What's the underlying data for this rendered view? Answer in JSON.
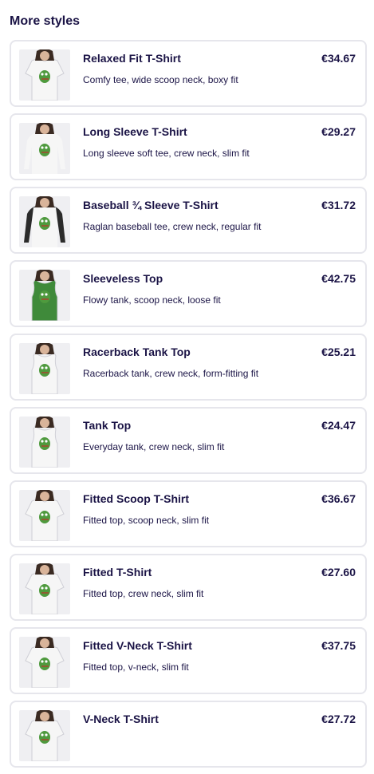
{
  "section": {
    "title": "More styles"
  },
  "products": [
    {
      "name": "Relaxed Fit T-Shirt",
      "price": "€34.67",
      "desc": "Comfy tee, wide scoop neck, boxy fit",
      "garment": "tshirt",
      "color": "#f6f6f6",
      "sleeve": "#f6f6f6",
      "icon": "relaxed-fit-tshirt-thumbnail-icon"
    },
    {
      "name": "Long Sleeve T-Shirt",
      "price": "€29.27",
      "desc": "Long sleeve soft tee, crew neck, slim fit",
      "garment": "longsleeve",
      "color": "#f6f6f6",
      "sleeve": "#f6f6f6",
      "icon": "long-sleeve-tshirt-thumbnail-icon"
    },
    {
      "name": "Baseball ¾ Sleeve T-Shirt",
      "price": "€31.72",
      "desc": "Raglan baseball tee, crew neck, regular fit",
      "garment": "longsleeve",
      "color": "#f6f6f6",
      "sleeve": "#2b2b2b",
      "icon": "baseball-sleeve-tshirt-thumbnail-icon"
    },
    {
      "name": "Sleeveless Top",
      "price": "€42.75",
      "desc": "Flowy tank, scoop neck, loose fit",
      "garment": "tank",
      "color": "#3f8a3a",
      "sleeve": "#3f8a3a",
      "icon": "sleeveless-top-thumbnail-icon"
    },
    {
      "name": "Racerback Tank Top",
      "price": "€25.21",
      "desc": "Racerback tank, crew neck, form-fitting fit",
      "garment": "tank",
      "color": "#f6f6f6",
      "sleeve": "#f6f6f6",
      "icon": "racerback-tank-thumbnail-icon"
    },
    {
      "name": "Tank Top",
      "price": "€24.47",
      "desc": "Everyday tank, crew neck, slim fit",
      "garment": "tank",
      "color": "#f6f6f6",
      "sleeve": "#f6f6f6",
      "icon": "tank-top-thumbnail-icon"
    },
    {
      "name": "Fitted Scoop T-Shirt",
      "price": "€36.67",
      "desc": "Fitted top, scoop neck, slim fit",
      "garment": "tshirt",
      "color": "#f6f6f6",
      "sleeve": "#f6f6f6",
      "icon": "fitted-scoop-tshirt-thumbnail-icon"
    },
    {
      "name": "Fitted T-Shirt",
      "price": "€27.60",
      "desc": "Fitted top, crew neck, slim fit",
      "garment": "tshirt",
      "color": "#f6f6f6",
      "sleeve": "#f6f6f6",
      "icon": "fitted-tshirt-thumbnail-icon"
    },
    {
      "name": "Fitted V-Neck T-Shirt",
      "price": "€37.75",
      "desc": "Fitted top, v-neck, slim fit",
      "garment": "tshirt",
      "color": "#f6f6f6",
      "sleeve": "#f6f6f6",
      "icon": "fitted-vneck-tshirt-thumbnail-icon"
    },
    {
      "name": "V-Neck T-Shirt",
      "price": "€27.72",
      "desc": "",
      "garment": "tshirt",
      "color": "#f6f6f6",
      "sleeve": "#f6f6f6",
      "icon": "vneck-tshirt-thumbnail-icon"
    }
  ],
  "colors": {
    "text": "#1b1446",
    "border": "#e6e6ec",
    "thumb_bg": "#efeff2",
    "print_green": "#4f9a3e"
  }
}
